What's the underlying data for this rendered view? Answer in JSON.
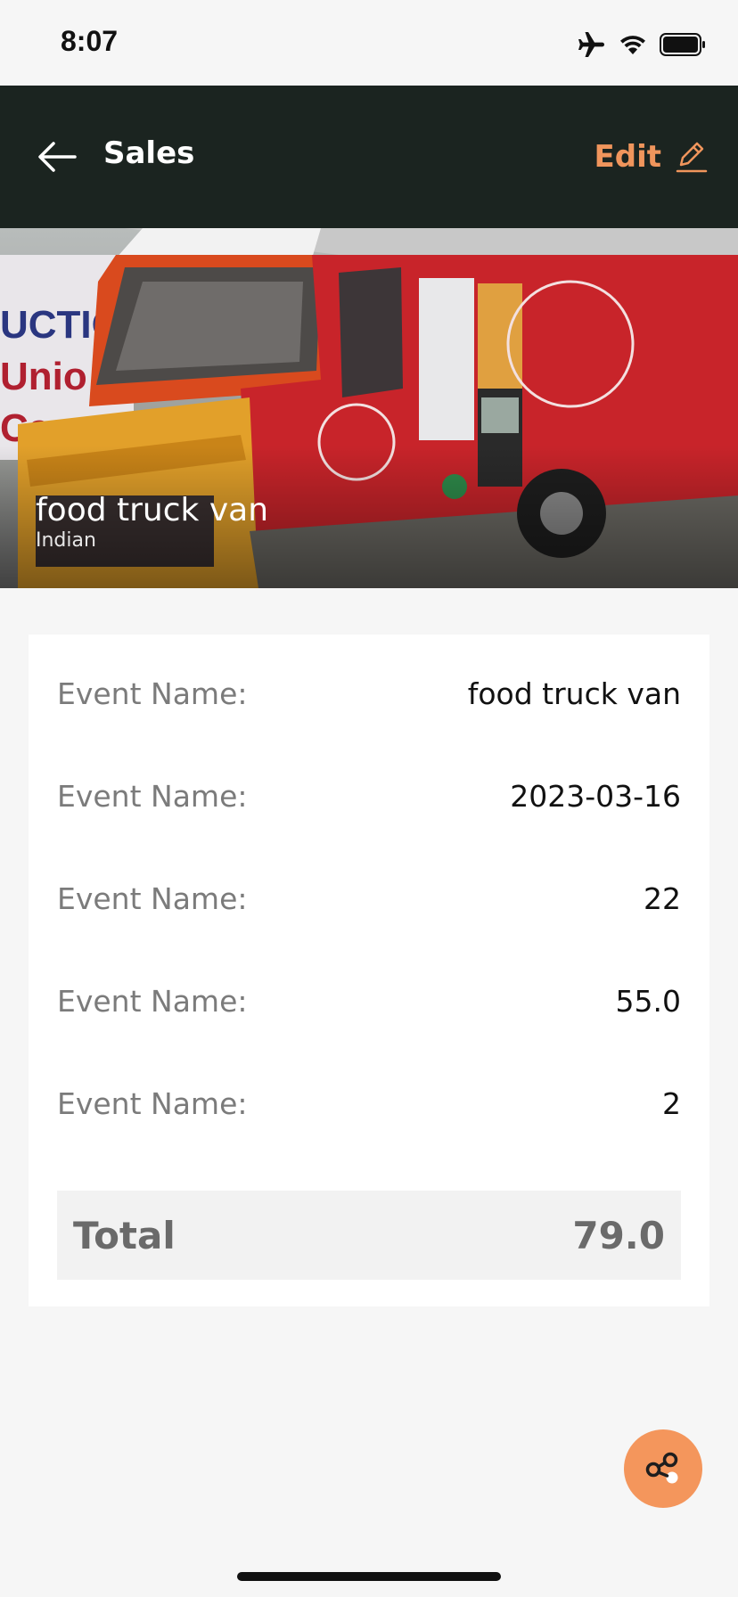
{
  "status_bar": {
    "time": "8:07"
  },
  "header": {
    "title": "Sales",
    "edit_label": "Edit"
  },
  "hero": {
    "title": "food truck van",
    "subtitle": "Indian",
    "banner_text_lines": [
      "UCTIO",
      "Unio",
      "Ca"
    ]
  },
  "details": {
    "rows": [
      {
        "label": "Event Name:",
        "value": "food truck van"
      },
      {
        "label": "Event Name:",
        "value": "2023-03-16"
      },
      {
        "label": "Event Name:",
        "value": "22"
      },
      {
        "label": "Event Name:",
        "value": "55.0"
      },
      {
        "label": "Event Name:",
        "value": "2"
      }
    ],
    "total_label": "Total",
    "total_value": "79.0"
  },
  "colors": {
    "header_bg": "#1b2420",
    "accent": "#f0955c",
    "fab": "#f4965c"
  },
  "icons": {
    "back": "arrow-left-icon",
    "edit": "pencil-icon",
    "share": "share-nodes-icon",
    "airplane": "airplane-icon",
    "wifi": "wifi-icon",
    "battery": "battery-icon"
  }
}
